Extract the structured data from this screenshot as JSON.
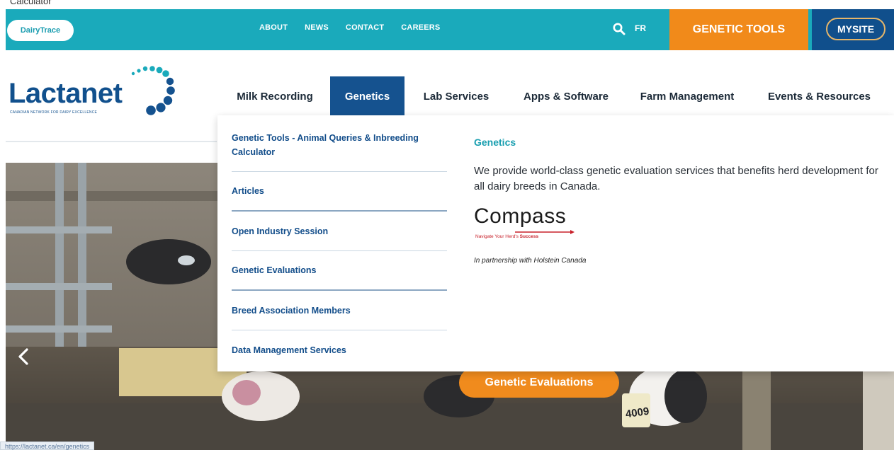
{
  "page_caption": "Calculator",
  "topbar": {
    "dairytrace_label": "DairyTrace",
    "links": [
      "ABOUT",
      "NEWS",
      "CONTACT",
      "CAREERS"
    ],
    "language_label": "FR",
    "genetic_tools_label": "GENETIC TOOLS",
    "mysite_label": "MYSITE",
    "bar_color": "#1aaabb",
    "accent_orange": "#f18a1a",
    "brand_navy": "#104f8c"
  },
  "logo": {
    "wordmark": "Lactanet",
    "tagline": "CANADIAN NETWORK FOR DAIRY EXCELLENCE"
  },
  "main_nav": {
    "items": [
      "Milk Recording",
      "Genetics",
      "Lab Services",
      "Apps & Software",
      "Farm Management",
      "Events & Resources"
    ],
    "active": "Genetics"
  },
  "mega_menu": {
    "links": [
      "Genetic Tools - Animal Queries & Inbreeding Calculator",
      "Articles",
      "Open Industry Session",
      "Genetic Evaluations",
      "Breed Association Members",
      "Data Management Services"
    ],
    "title": "Genetics",
    "description": "We provide world-class genetic evaluation services that benefits herd development for all dairy breeds in Canada.",
    "compass_word": "Compass",
    "compass_tagline_prefix": "Navigate Your Herd's ",
    "compass_tagline_emphasis": "Success",
    "partnership": "In partnership with Holstein Canada"
  },
  "hero": {
    "cta_label": "Genetic Evaluations",
    "ear_tag": "4009",
    "prev_icon": "chevron-left-icon"
  },
  "status_bar": {
    "url": "https://lactanet.ca/en/genetics"
  }
}
